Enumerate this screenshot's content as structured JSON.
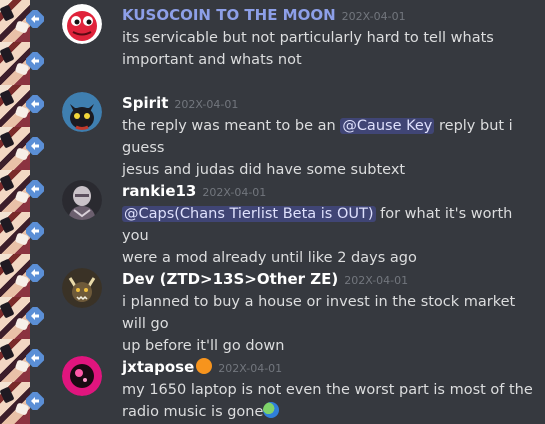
{
  "colors": {
    "background": "#36393f",
    "username": "#ffffff",
    "username_highlight": "#8d9fe8",
    "text": "#dcddde",
    "timestamp": "#72767d",
    "mention_bg": "rgba(88,101,242,0.3)",
    "mention_text": "#dee0fc"
  },
  "messages": [
    {
      "username": "KUSOCOIN TO THE MOON",
      "timestamp": "202X-04-01",
      "avatar": "red-pepe-avatar",
      "line1": "its servicable but not particularly hard to tell whats",
      "line2": "important and whats not"
    },
    {
      "username": "Spirit",
      "timestamp": "202X-04-01",
      "avatar": "black-cat-avatar",
      "line1_pre": "the reply was meant to be an ",
      "mention": "@Cause Key",
      "line1_post": " reply but i guess",
      "line2": "jesus and judas did have some subtext"
    },
    {
      "username": "rankie13",
      "timestamp": "202X-04-01",
      "avatar": "armored-figure-avatar",
      "mention": "@Caps(Chans Tierlist Beta is OUT)",
      "line1_post": " for what it's worth you",
      "line2": "were a mod already until like 2 days ago"
    },
    {
      "username": "Dev (ZTD>13S>Other ZE)",
      "timestamp": "202X-04-01",
      "avatar": "horned-creature-avatar",
      "line1": "i planned to buy a house or invest in the stock market will go",
      "line2": "up before it'll go down"
    },
    {
      "username": "jxtapose",
      "timestamp": "202X-04-01",
      "avatar": "pink-orb-avatar",
      "name_emoji": "orange-icon",
      "line1": "my 1650 laptop is not even the worst part is most of the",
      "line2": "radio music is gone",
      "end_emoji": "earth-globe-icon"
    }
  ]
}
